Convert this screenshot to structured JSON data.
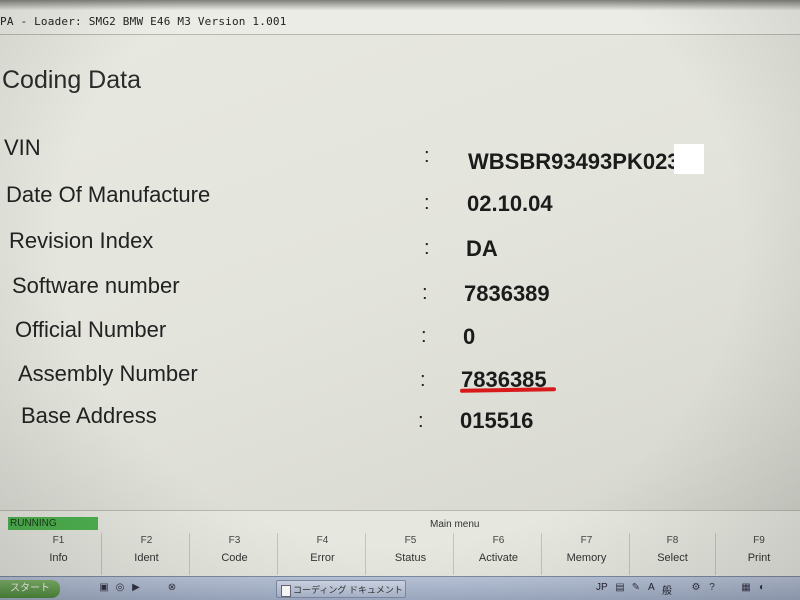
{
  "window": {
    "title": "PA - Loader: SMG2 BMW E46 M3 Version 1.001"
  },
  "page": {
    "title": "Coding Data"
  },
  "rows": [
    {
      "label": "VIN",
      "value": "WBSBR93493PK023"
    },
    {
      "label": "Date Of Manufacture",
      "value": "02.10.04"
    },
    {
      "label": "Revision Index",
      "value": "DA"
    },
    {
      "label": "Software number",
      "value": "7836389"
    },
    {
      "label": "Official Number",
      "value": "0"
    },
    {
      "label": "Assembly Number",
      "value": "7836385"
    },
    {
      "label": "Base Address",
      "value": "015516"
    }
  ],
  "separator": ":",
  "status": {
    "text": "RUNNING",
    "color": "#4fb24f"
  },
  "menu": {
    "title": "Main menu",
    "keys": [
      {
        "key": "F1",
        "label": "Info"
      },
      {
        "key": "F2",
        "label": "Ident"
      },
      {
        "key": "F3",
        "label": "Code"
      },
      {
        "key": "F4",
        "label": "Error"
      },
      {
        "key": "F5",
        "label": "Status"
      },
      {
        "key": "F6",
        "label": "Activate"
      },
      {
        "key": "F7",
        "label": "Memory"
      },
      {
        "key": "F8",
        "label": "Select"
      },
      {
        "key": "F9",
        "label": "Print"
      }
    ]
  },
  "taskbar": {
    "start_label": "スタート",
    "task_label": "コーディング ドキュメント",
    "lang": "JP",
    "caps": "A",
    "kana": "般"
  },
  "colors": {
    "underline_mark": "#d81a1a"
  }
}
